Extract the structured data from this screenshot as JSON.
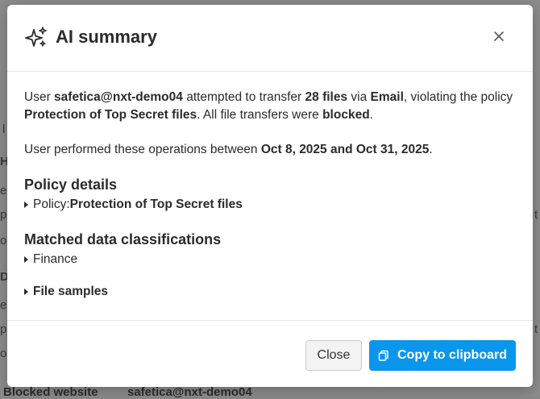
{
  "background": {
    "fragments_left": [
      "l",
      "H",
      "er",
      "p",
      "oc",
      "D",
      "er",
      "p",
      "oc"
    ],
    "fragments_right": [
      "t",
      "t"
    ],
    "bottom_row": {
      "label": "Blocked website",
      "user": "safetica@nxt-demo04"
    }
  },
  "modal": {
    "title": "AI summary",
    "summary": {
      "prefix": "User ",
      "user": "safetica@nxt-demo04",
      "mid1": " attempted to transfer ",
      "count": "28 files",
      "mid2": " via ",
      "channel": "Email",
      "mid3": ", violating the policy ",
      "policy": "Protection of Top Secret files",
      "mid4": ". All file transfers were ",
      "result": "blocked",
      "end": "."
    },
    "period": {
      "prefix": "User performed these operations between ",
      "range": "Oct 8, 2025 and Oct 31, 2025",
      "end": "."
    },
    "policy_details": {
      "heading": "Policy details",
      "label": "Policy: ",
      "value": "Protection of Top Secret files"
    },
    "classifications": {
      "heading": "Matched data classifications",
      "item": "Finance"
    },
    "file_samples": "File samples",
    "buttons": {
      "close": "Close",
      "copy": "Copy to clipboard"
    }
  },
  "colors": {
    "primary": "#0a96ec",
    "overlay": "#8c8c8c"
  }
}
